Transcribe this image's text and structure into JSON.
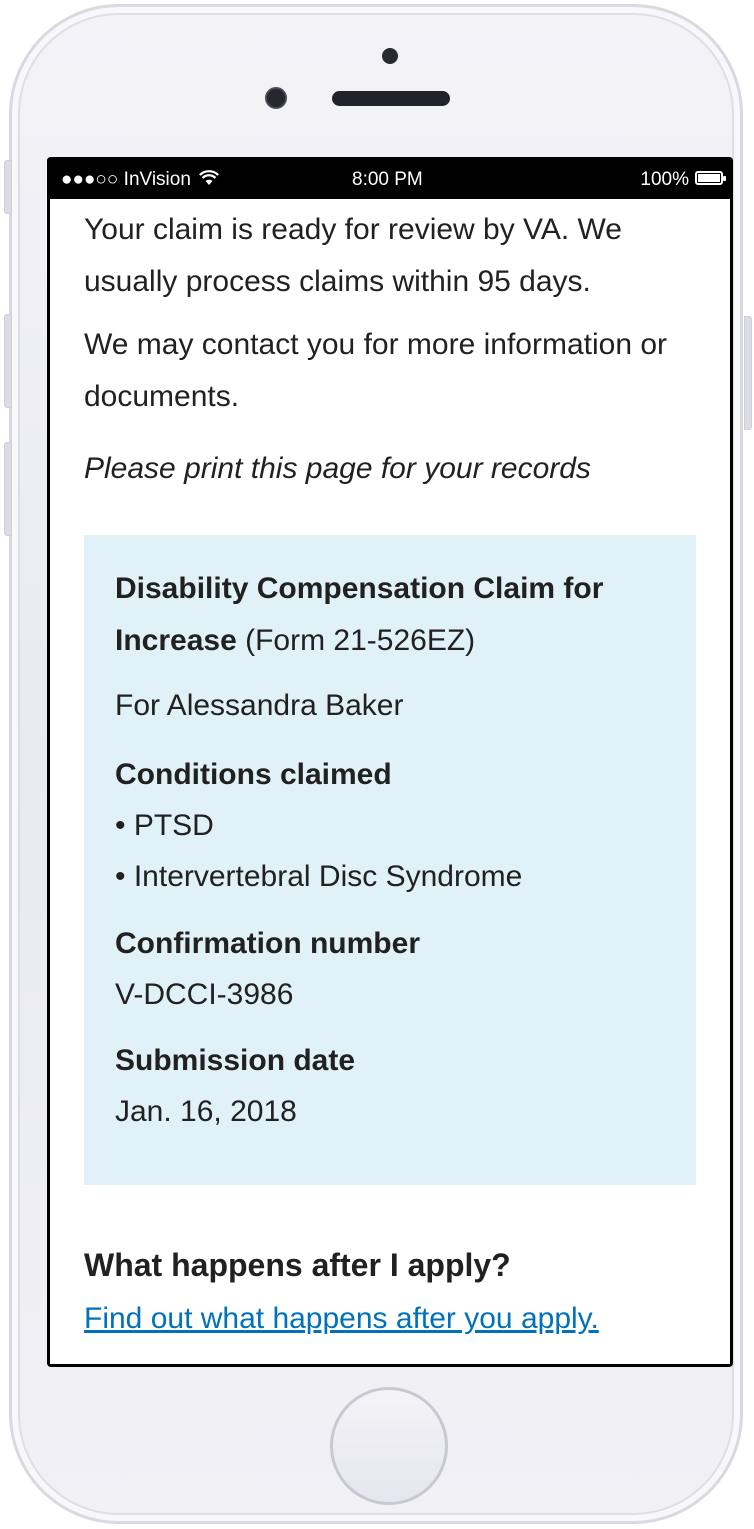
{
  "status_bar": {
    "carrier": "●●●○○ InVision",
    "wifi_icon": "wifi-icon",
    "time": "8:00 PM",
    "battery": "100%"
  },
  "intro": {
    "ready": "Your claim is ready for review by VA. We usually process claims within 95 days.",
    "contact": "We may contact you for more information or documents.",
    "print": "Please print this page for your records"
  },
  "summary": {
    "title_bold": "Disability Compensation Claim for Increase",
    "title_form": " (Form 21-526EZ)",
    "for_name": "For Alessandra Baker",
    "conditions_heading": "Conditions claimed",
    "conditions": [
      "• PTSD",
      "• Intervertebral Disc Syndrome"
    ],
    "confirmation_heading": "Confirmation number",
    "confirmation_number": "V-DCCI-3986",
    "submission_heading": "Submission date",
    "submission_date": "Jan. 16, 2018"
  },
  "after": {
    "heading": "What happens after I apply?",
    "link": "Find out what happens after you apply."
  },
  "colors": {
    "card_background": "#e1f1f8",
    "link": "#0071bb",
    "text": "#212121"
  }
}
